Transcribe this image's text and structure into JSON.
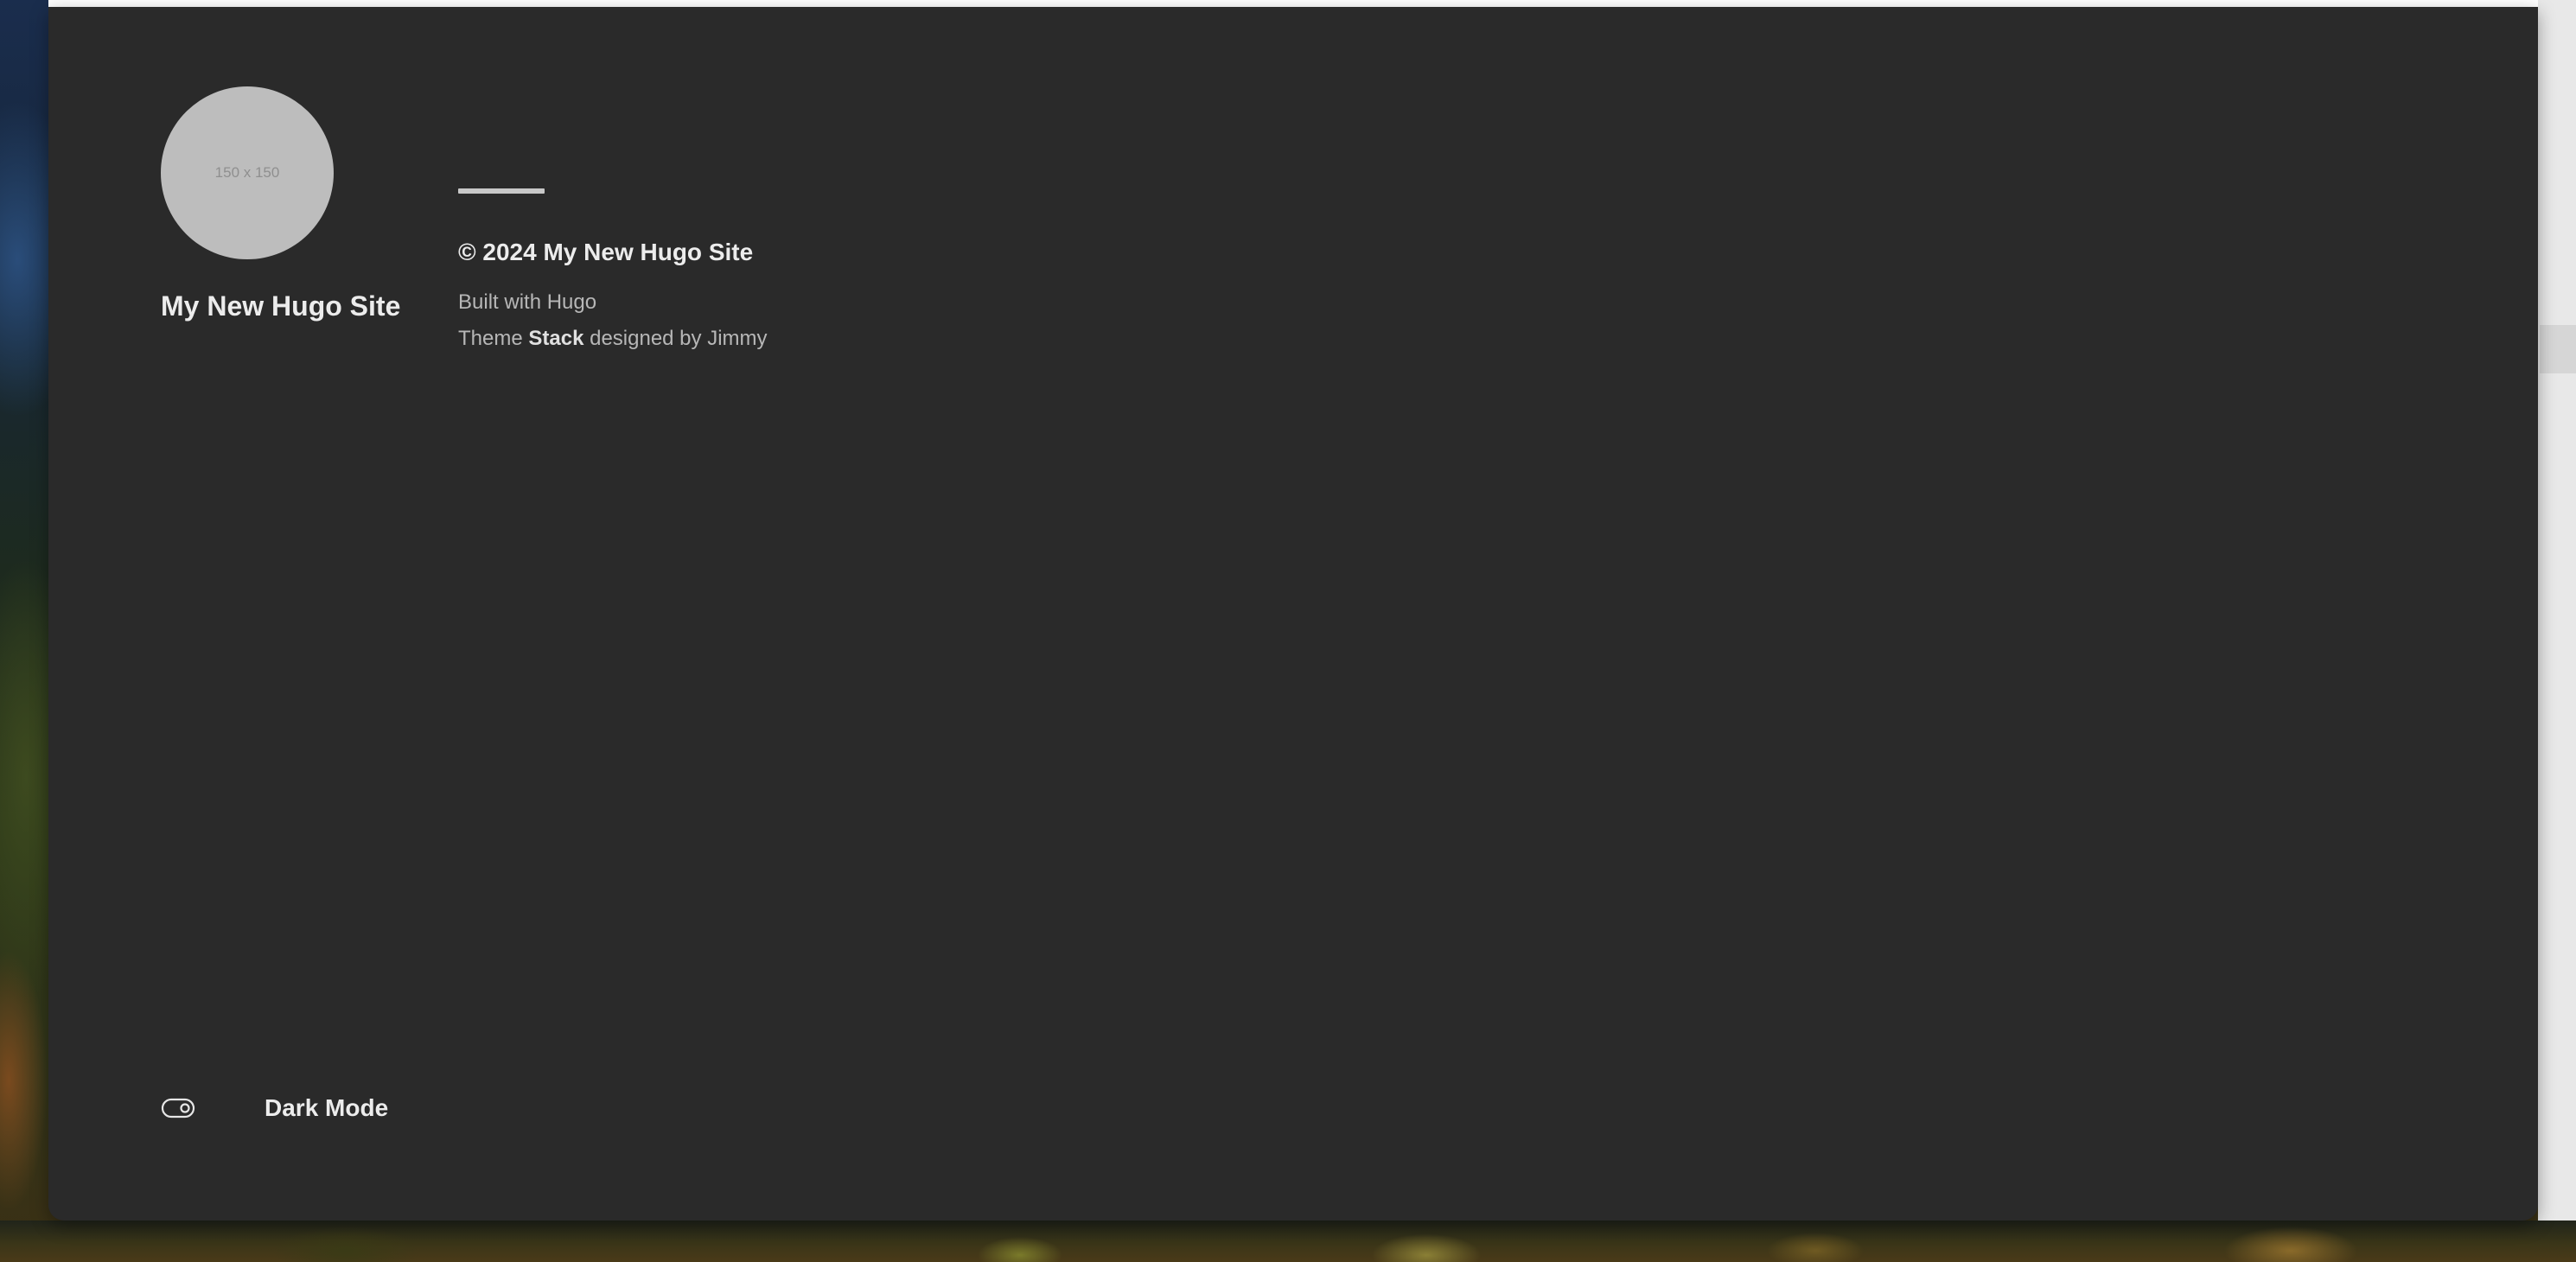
{
  "sidebar": {
    "avatar_placeholder": "150 x 150",
    "site_name": "My New Hugo Site",
    "dark_mode_label": "Dark Mode",
    "toggle_icon": "toggle-icon"
  },
  "footer": {
    "copyright": "© 2024 My New Hugo Site",
    "built_with": "Built with Hugo",
    "theme_prefix": "Theme",
    "theme_name": "Stack",
    "theme_suffix": "designed by Jimmy"
  },
  "colors": {
    "panel_bg": "#2a2a2a",
    "text_primary": "#ececec",
    "text_secondary": "#b7b7b7",
    "avatar_bg": "#bdbdbd"
  }
}
